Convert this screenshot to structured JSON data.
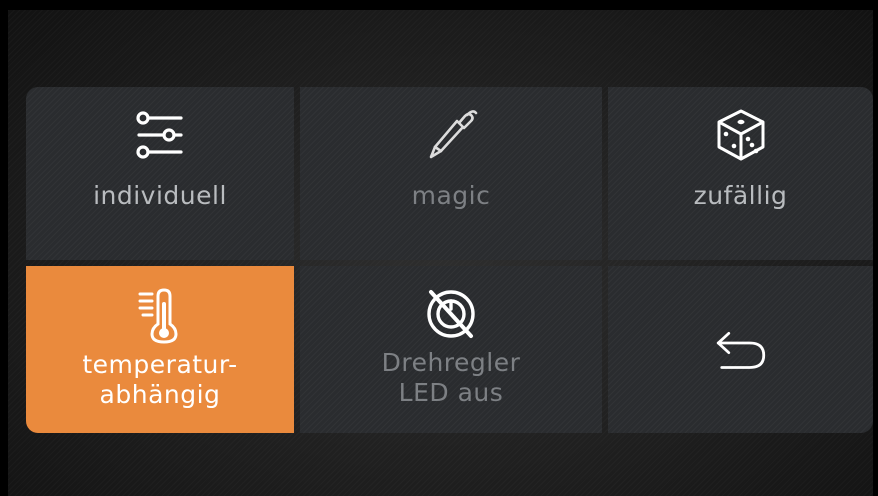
{
  "menu": {
    "tiles": [
      {
        "label": "individuell",
        "icon": "sliders-icon",
        "state": "normal"
      },
      {
        "label": "magic",
        "icon": "pen-icon",
        "state": "dimmed"
      },
      {
        "label": "zufällig",
        "icon": "dice-icon",
        "state": "normal"
      },
      {
        "label_line1": "temperatur-",
        "label_line2": "abhängig",
        "icon": "thermometer-icon",
        "state": "selected"
      },
      {
        "label_line1": "Drehregler",
        "label_line2": "LED aus",
        "icon": "knob-off-icon",
        "state": "dimmed"
      },
      {
        "label": "",
        "icon": "back-arrow-icon",
        "state": "normal"
      }
    ]
  },
  "colors": {
    "accent": "#ea8a3d",
    "tile_background": "#2a2c2f",
    "text_normal": "#b9bcbf",
    "text_dimmed": "#7d8084"
  }
}
